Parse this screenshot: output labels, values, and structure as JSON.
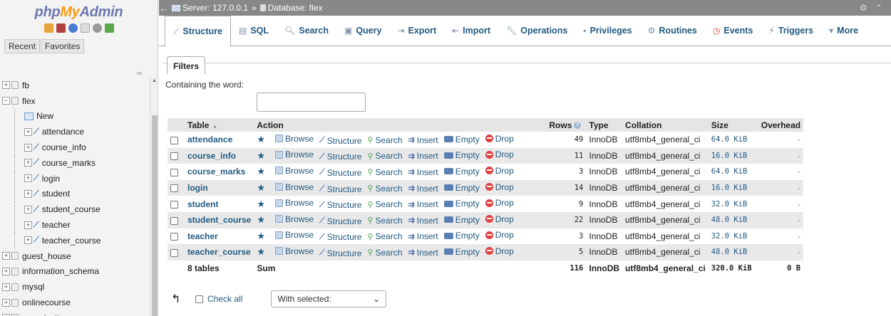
{
  "sidebar": {
    "logo_php": "php",
    "logo_my": "My",
    "logo_admin": "Admin",
    "tabs": [
      "Recent",
      "Favorites"
    ],
    "tree": [
      {
        "label": "fb",
        "kind": "db",
        "expanded": false
      },
      {
        "label": "flex",
        "kind": "db",
        "expanded": true
      },
      {
        "label": "New",
        "kind": "new"
      },
      {
        "label": "attendance",
        "kind": "table"
      },
      {
        "label": "course_info",
        "kind": "table"
      },
      {
        "label": "course_marks",
        "kind": "table"
      },
      {
        "label": "login",
        "kind": "table"
      },
      {
        "label": "student",
        "kind": "table"
      },
      {
        "label": "student_course",
        "kind": "table"
      },
      {
        "label": "teacher",
        "kind": "table"
      },
      {
        "label": "teacher_course",
        "kind": "table"
      },
      {
        "label": "guest_house",
        "kind": "db",
        "expanded": false
      },
      {
        "label": "information_schema",
        "kind": "db",
        "expanded": false
      },
      {
        "label": "mysql",
        "kind": "db",
        "expanded": false
      },
      {
        "label": "onlinecourse",
        "kind": "db",
        "expanded": false
      },
      {
        "label": "organization",
        "kind": "db",
        "expanded": false
      }
    ]
  },
  "topbar": {
    "server": "Server: 127.0.0.1",
    "separator": "»",
    "database": "Database: flex"
  },
  "tabs": [
    {
      "label": "Structure",
      "icon": "structure-icon",
      "active": true
    },
    {
      "label": "SQL",
      "icon": "sql-icon"
    },
    {
      "label": "Search",
      "icon": "search-icon"
    },
    {
      "label": "Query",
      "icon": "query-icon"
    },
    {
      "label": "Export",
      "icon": "export-icon"
    },
    {
      "label": "Import",
      "icon": "import-icon"
    },
    {
      "label": "Operations",
      "icon": "wrench-icon"
    },
    {
      "label": "Privileges",
      "icon": "privileges-icon"
    },
    {
      "label": "Routines",
      "icon": "routines-icon"
    },
    {
      "label": "Events",
      "icon": "clock-icon"
    },
    {
      "label": "Triggers",
      "icon": "triggers-icon"
    },
    {
      "label": "More",
      "icon": "chevron-down-icon"
    }
  ],
  "filters": {
    "legend": "Filters",
    "label": "Containing the word:",
    "value": ""
  },
  "table": {
    "headers": {
      "table": "Table",
      "action": "Action",
      "rows": "Rows",
      "type": "Type",
      "collation": "Collation",
      "size": "Size",
      "overhead": "Overhead"
    },
    "actions": [
      "Browse",
      "Structure",
      "Search",
      "Insert",
      "Empty",
      "Drop"
    ],
    "rows": [
      {
        "name": "attendance",
        "rows": "49",
        "type": "InnoDB",
        "collation": "utf8mb4_general_ci",
        "size": "64.0 KiB",
        "overhead": "-"
      },
      {
        "name": "course_info",
        "rows": "11",
        "type": "InnoDB",
        "collation": "utf8mb4_general_ci",
        "size": "16.0 KiB",
        "overhead": "-"
      },
      {
        "name": "course_marks",
        "rows": "3",
        "type": "InnoDB",
        "collation": "utf8mb4_general_ci",
        "size": "64.0 KiB",
        "overhead": "-"
      },
      {
        "name": "login",
        "rows": "14",
        "type": "InnoDB",
        "collation": "utf8mb4_general_ci",
        "size": "16.0 KiB",
        "overhead": "-"
      },
      {
        "name": "student",
        "rows": "9",
        "type": "InnoDB",
        "collation": "utf8mb4_general_ci",
        "size": "32.0 KiB",
        "overhead": "-"
      },
      {
        "name": "student_course",
        "rows": "22",
        "type": "InnoDB",
        "collation": "utf8mb4_general_ci",
        "size": "48.0 KiB",
        "overhead": "-"
      },
      {
        "name": "teacher",
        "rows": "3",
        "type": "InnoDB",
        "collation": "utf8mb4_general_ci",
        "size": "32.0 KiB",
        "overhead": "-"
      },
      {
        "name": "teacher_course",
        "rows": "5",
        "type": "InnoDB",
        "collation": "utf8mb4_general_ci",
        "size": "48.0 KiB",
        "overhead": "-"
      }
    ],
    "summary": {
      "count": "8 tables",
      "label": "Sum",
      "rows": "116",
      "type": "InnoDB",
      "collation": "utf8mb4_general_ci",
      "size": "320.0 KiB",
      "overhead": "0 B"
    }
  },
  "bottom": {
    "check_all": "Check all",
    "with_selected": "With selected:"
  }
}
